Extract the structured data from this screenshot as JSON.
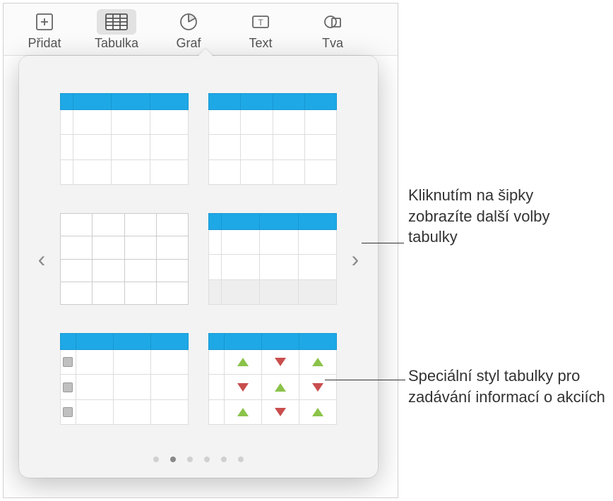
{
  "toolbar": {
    "items": [
      {
        "label": "Přidat",
        "icon": "plus-page-icon",
        "selected": false
      },
      {
        "label": "Tabulka",
        "icon": "table-icon",
        "selected": true
      },
      {
        "label": "Graf",
        "icon": "pie-chart-icon",
        "selected": false
      },
      {
        "label": "Text",
        "icon": "text-box-icon",
        "selected": false
      },
      {
        "label": "Tva",
        "icon": "shapes-icon",
        "selected": false
      }
    ]
  },
  "popover": {
    "nav_left": "‹",
    "nav_right": "›",
    "pages": 6,
    "active_page": 1,
    "styles": [
      {
        "name": "header-plain",
        "header": true,
        "firstCol": true
      },
      {
        "name": "header-simple",
        "header": true,
        "firstCol": false
      },
      {
        "name": "no-header-grid",
        "header": false,
        "firstCol": false
      },
      {
        "name": "header-footer",
        "header": true,
        "firstCol": true,
        "footer": true
      },
      {
        "name": "checkbox-rows",
        "header": true,
        "checkboxes": true
      },
      {
        "name": "stock-triangles",
        "header": true,
        "triangles": true
      }
    ]
  },
  "callouts": {
    "arrow": "Kliknutím na šipky zobrazíte další volby tabulky",
    "stock": "Speciální styl tabulky pro zadávání informací o akciích"
  }
}
